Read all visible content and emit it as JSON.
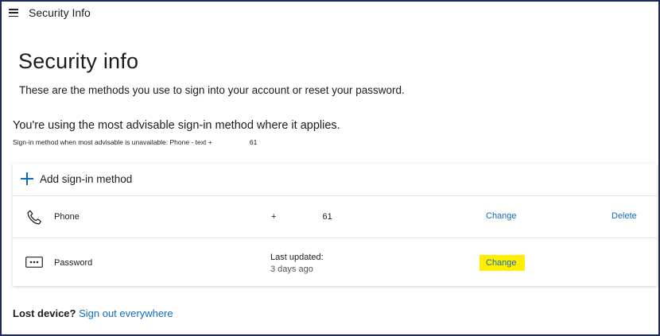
{
  "window": {
    "title": "Security Info"
  },
  "page": {
    "title": "Security info",
    "subtitle": "These are the methods you use to sign into your account or reset your password."
  },
  "advice": {
    "main": "You're using the most advisable sign-in method where it applies.",
    "sub": "Sign-in method when most advisable is unavailable: Phone - text +                    61"
  },
  "methods": {
    "add_label": "Add sign-in method",
    "rows": [
      {
        "name": "Phone",
        "detail": "+                   61",
        "change_label": "Change",
        "delete_label": "Delete"
      },
      {
        "name": "Password",
        "detail_label": "Last updated:",
        "detail_value": "3 days ago",
        "change_label": "Change"
      }
    ]
  },
  "footer": {
    "question": "Lost device?",
    "link": "Sign out everywhere"
  },
  "colors": {
    "link": "#0f6cbd",
    "highlight": "#ffee00",
    "frame": "#1f2a5a"
  }
}
